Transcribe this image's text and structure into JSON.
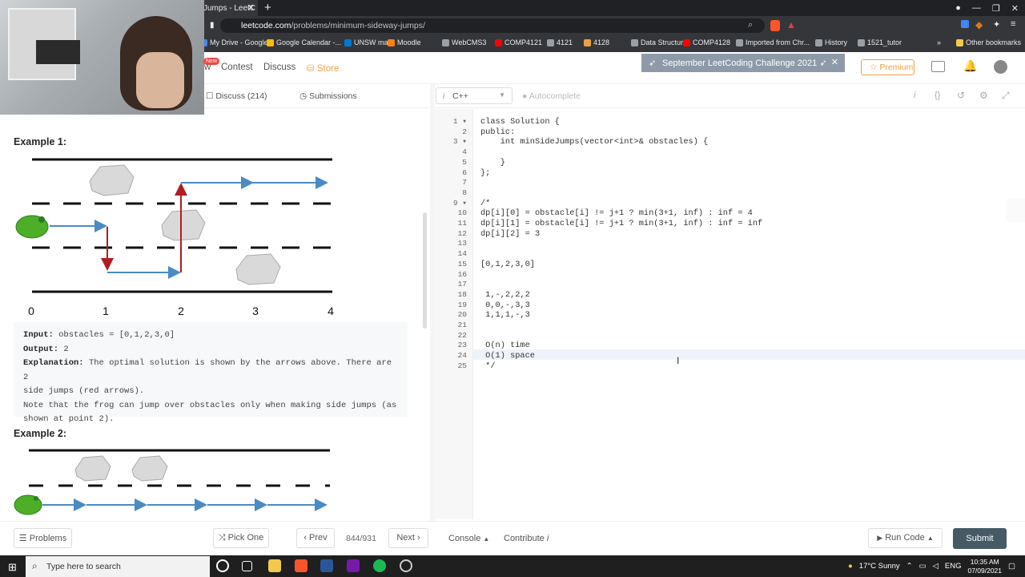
{
  "browser": {
    "tab_title": "Jumps - LeetC",
    "url_domain": "leetcode.com",
    "url_path": "/problems/minimum-sideway-jumps/",
    "bookmarks": [
      {
        "label": "My Drive - Google...",
        "color": "#4285f4"
      },
      {
        "label": "Google Calendar -...",
        "color": "#fbbc04"
      },
      {
        "label": "UNSW mail",
        "color": "#0078d4"
      },
      {
        "label": "Moodle",
        "color": "#f98012"
      },
      {
        "label": "WebCMS3",
        "color": "#9aa0a6"
      },
      {
        "label": "COMP4121",
        "color": "#ff0000"
      },
      {
        "label": "4121",
        "color": "#9aa0a6"
      },
      {
        "label": "4128",
        "color": "#f0a040"
      },
      {
        "label": "Data Structures",
        "color": "#9aa0a6"
      },
      {
        "label": "COMP4128",
        "color": "#ff0000"
      },
      {
        "label": "Imported from Chr...",
        "color": "#9aa0a6"
      },
      {
        "label": "History",
        "color": "#9aa0a6"
      },
      {
        "label": "1521_tutor",
        "color": "#9aa0a6"
      }
    ],
    "other_bookmarks": "Other bookmarks"
  },
  "nav": {
    "new_badge": "New",
    "view_fragment": "w",
    "contest": "Contest",
    "discuss": "Discuss",
    "store": "Store",
    "banner": "September LeetCoding Challenge 2021",
    "premium": "Premium"
  },
  "left_tabs": {
    "discuss": "Discuss (214)",
    "submissions": "Submissions"
  },
  "problem": {
    "example1_title": "Example 1:",
    "example1": {
      "input_label": "Input:",
      "input_value": "obstacles = [0,1,2,3,0]",
      "output_label": "Output:",
      "output_value": "2",
      "explanation_label": "Explanation:",
      "explanation_line1": "The optimal solution is shown by the arrows above. There are 2",
      "explanation_line2": "side jumps (red arrows).",
      "explanation_line3": "Note that the frog can jump over obstacles only when making side jumps (as",
      "explanation_line4": "shown at point 2)."
    },
    "diagram_ticks": [
      "0",
      "1",
      "2",
      "3",
      "4"
    ],
    "example2_title": "Example 2:"
  },
  "editor": {
    "language": "C++",
    "autocomplete": "Autocomplete",
    "lines": [
      "class Solution {",
      "public:",
      "    int minSideJumps(vector<int>& obstacles) {",
      "",
      "    }",
      "};",
      "",
      "",
      "/*",
      "dp[i][0] = obstacle[i] != j+1 ? min(3+1, inf) : inf = 4",
      "dp[i][1] = obstacle[i] != j+1 ? min(3+1, inf) : inf = inf",
      "dp[i][2] = 3",
      "",
      "",
      "[0,1,2,3,0]",
      "",
      "",
      " 1,-,2,2,2",
      " 0,0,-,3,3",
      " 1,1,1,-,3",
      "",
      "",
      " O(n) time",
      " O(1) space",
      " */"
    ]
  },
  "bottom": {
    "problems": "Problems",
    "pick_one": "Pick One",
    "prev": "Prev",
    "counter": "844/931",
    "next": "Next",
    "console": "Console",
    "contribute": "Contribute",
    "run_code": "Run Code",
    "submit": "Submit"
  },
  "taskbar": {
    "search_placeholder": "Type here to search",
    "weather": "17°C  Sunny",
    "lang": "ENG",
    "time": "10:35 AM",
    "date": "07/09/2021"
  },
  "colors": {
    "red_arrow": "#b01c22",
    "blue_arrow": "#4a8bc3",
    "submit_bg": "#455a64",
    "store": "#f0a040"
  }
}
